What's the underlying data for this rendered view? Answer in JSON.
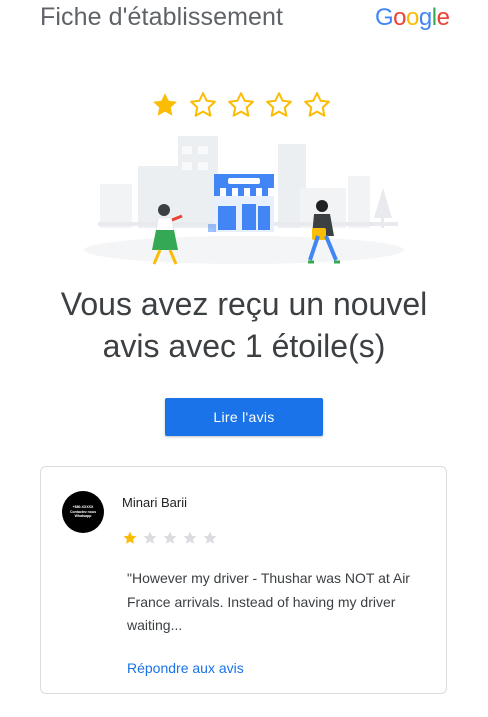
{
  "header": {
    "title": "Fiche d'établissement",
    "logo_letters": [
      "G",
      "o",
      "o",
      "g",
      "l",
      "e"
    ],
    "logo_colors": [
      "#4285f4",
      "#ea4335",
      "#fbbc05",
      "#4285f4",
      "#34a853",
      "#ea4335"
    ]
  },
  "rating": {
    "filled": 1,
    "total": 5,
    "star_color": "#fbbc04",
    "empty_star_color": "#dadce0"
  },
  "headline": {
    "line1": "Vous avez reçu un nouvel",
    "line2": "avis avec 1 étoile(s)"
  },
  "actions": {
    "read_label": "Lire l'avis",
    "accent": "#1a73e8"
  },
  "review": {
    "avatar_lines": [
      "+880-XXXXX",
      "Contactez nous",
      "Whatsapp"
    ],
    "reviewer_name": "Minari Barii",
    "stars": 1,
    "text_lines": [
      "\"However my driver - Thushar was NOT at Air",
      "France arrivals. Instead of having my driver",
      "waiting..."
    ],
    "reply_label": "Répondre aux avis"
  }
}
